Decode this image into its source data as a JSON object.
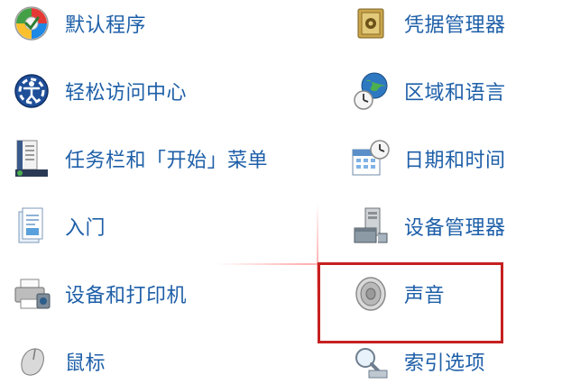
{
  "items": {
    "default_programs": {
      "label": "默认程序",
      "icon": "default-programs-icon"
    },
    "ease_of_access": {
      "label": "轻松访问中心",
      "icon": "ease-of-access-icon"
    },
    "taskbar_start": {
      "label": "任务栏和「开始」菜单",
      "icon": "taskbar-start-menu-icon"
    },
    "getting_started": {
      "label": "入门",
      "icon": "getting-started-icon"
    },
    "devices_printers": {
      "label": "设备和打印机",
      "icon": "devices-printers-icon"
    },
    "mouse": {
      "label": "鼠标",
      "icon": "mouse-icon"
    },
    "credential_manager": {
      "label": "凭据管理器",
      "icon": "credential-manager-icon"
    },
    "region_language": {
      "label": "区域和语言",
      "icon": "region-language-icon"
    },
    "date_time": {
      "label": "日期和时间",
      "icon": "date-time-icon"
    },
    "device_manager": {
      "label": "设备管理器",
      "icon": "device-manager-icon"
    },
    "sound": {
      "label": "声音",
      "icon": "speaker-icon"
    },
    "indexing_options": {
      "label": "索引选项",
      "icon": "indexing-options-icon"
    }
  },
  "colors": {
    "link_text": "#1e5fa8",
    "highlight_border": "#c62020"
  }
}
